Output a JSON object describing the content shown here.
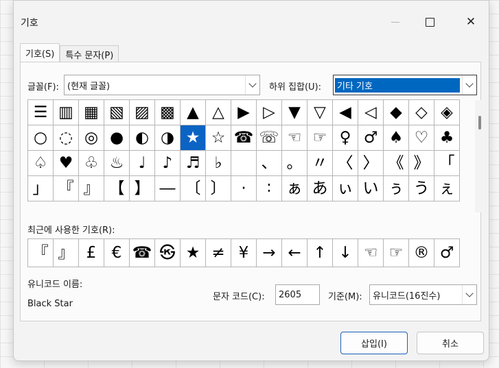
{
  "window": {
    "title": "기호"
  },
  "tabs": [
    {
      "label": "기호(S)",
      "active": true
    },
    {
      "label": "특수 문자(P)",
      "active": false
    }
  ],
  "font_label": "글꼴(F):",
  "font_value": "(현재 글꼴)",
  "subset_label": "하위 집합(U):",
  "subset_value": "기타 기호",
  "symbols": [
    "☰",
    "▥",
    "▦",
    "▧",
    "▨",
    "▩",
    "▲",
    "△",
    "▶",
    "▷",
    "▼",
    "▽",
    "◀",
    "◁",
    "◆",
    "◇",
    "◈",
    "○",
    "◌",
    "◎",
    "●",
    "◐",
    "◑",
    "★",
    "☆",
    "☎",
    "☏",
    "☜",
    "☞",
    "♀",
    "♂",
    "♠",
    "♡",
    "♣",
    "♤",
    "♥",
    "♧",
    "♨",
    "♩",
    "♪",
    "♬",
    "♭",
    "",
    "、",
    "。",
    "〃",
    "〈",
    "〉",
    "《",
    "》",
    "「",
    "」",
    "『",
    "』",
    "【",
    "】",
    "―",
    "〔",
    "〕",
    "·",
    "∶",
    "ぁ",
    "あ",
    "ぃ",
    "い",
    "ぅ",
    "う",
    "ぇ"
  ],
  "selected_index": 23,
  "recent_label": "최근에 사용한 기호(R):",
  "recent": [
    "『",
    "』",
    "£",
    "€",
    "☎",
    "㉿",
    "★",
    "≠",
    "¥",
    "→",
    "←",
    "↑",
    "↓",
    "☜",
    "☞",
    "®",
    "♂"
  ],
  "unicode_name_label": "유니코드 이름:",
  "unicode_name": "Black Star",
  "char_code_label": "문자 코드(C):",
  "char_code": "2605",
  "from_label": "기준(M):",
  "from_value": "유니코드(16진수)",
  "buttons": {
    "insert": "삽입(I)",
    "cancel": "취소"
  },
  "colors": {
    "selection": "#0b63c4",
    "accent": "#0067c0"
  }
}
